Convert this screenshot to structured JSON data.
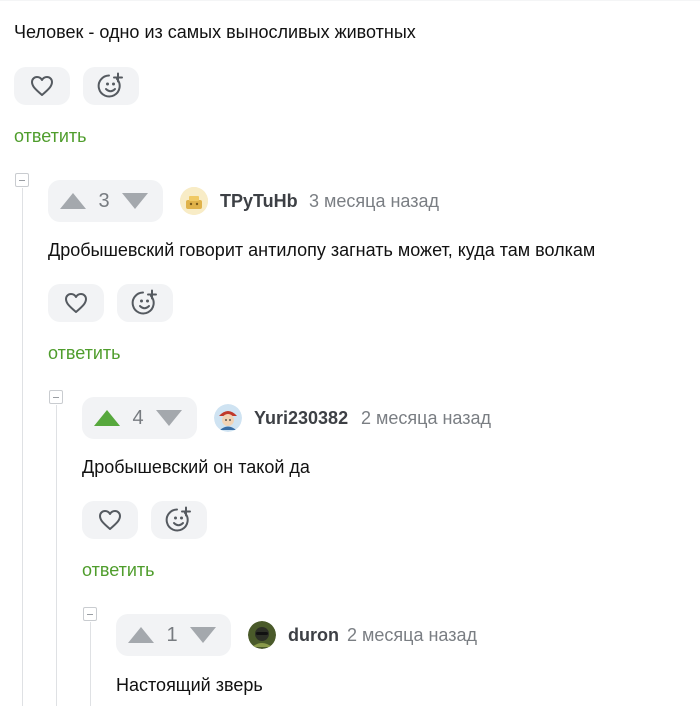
{
  "top_comment": {
    "text": "Человек - одно из самых выносливых животных",
    "reply_label": "ответить"
  },
  "comments": [
    {
      "votes": "3",
      "upvoted": false,
      "username": "TPyTuHb",
      "time": "3 месяца назад",
      "text": "Дробышевский говорит антилопу загнать может, куда там волкам",
      "reply_label": "ответить"
    },
    {
      "votes": "4",
      "upvoted": true,
      "username": "Yuri230382",
      "time": "2 месяца назад",
      "text": "Дробышевский он такой да",
      "reply_label": "ответить"
    },
    {
      "votes": "1",
      "upvoted": false,
      "username": "duron",
      "time": "2 месяца назад",
      "text": "Настоящий зверь"
    }
  ],
  "icons": {
    "like": "heart-icon",
    "react": "emoji-add-icon",
    "upvote": "arrow-up-icon",
    "downvote": "arrow-down-icon",
    "collapse": "collapse-icon"
  },
  "colors": {
    "accent_green": "#4f9d2c",
    "upvote_active": "#57a83d",
    "button_bg": "#f2f3f5"
  }
}
